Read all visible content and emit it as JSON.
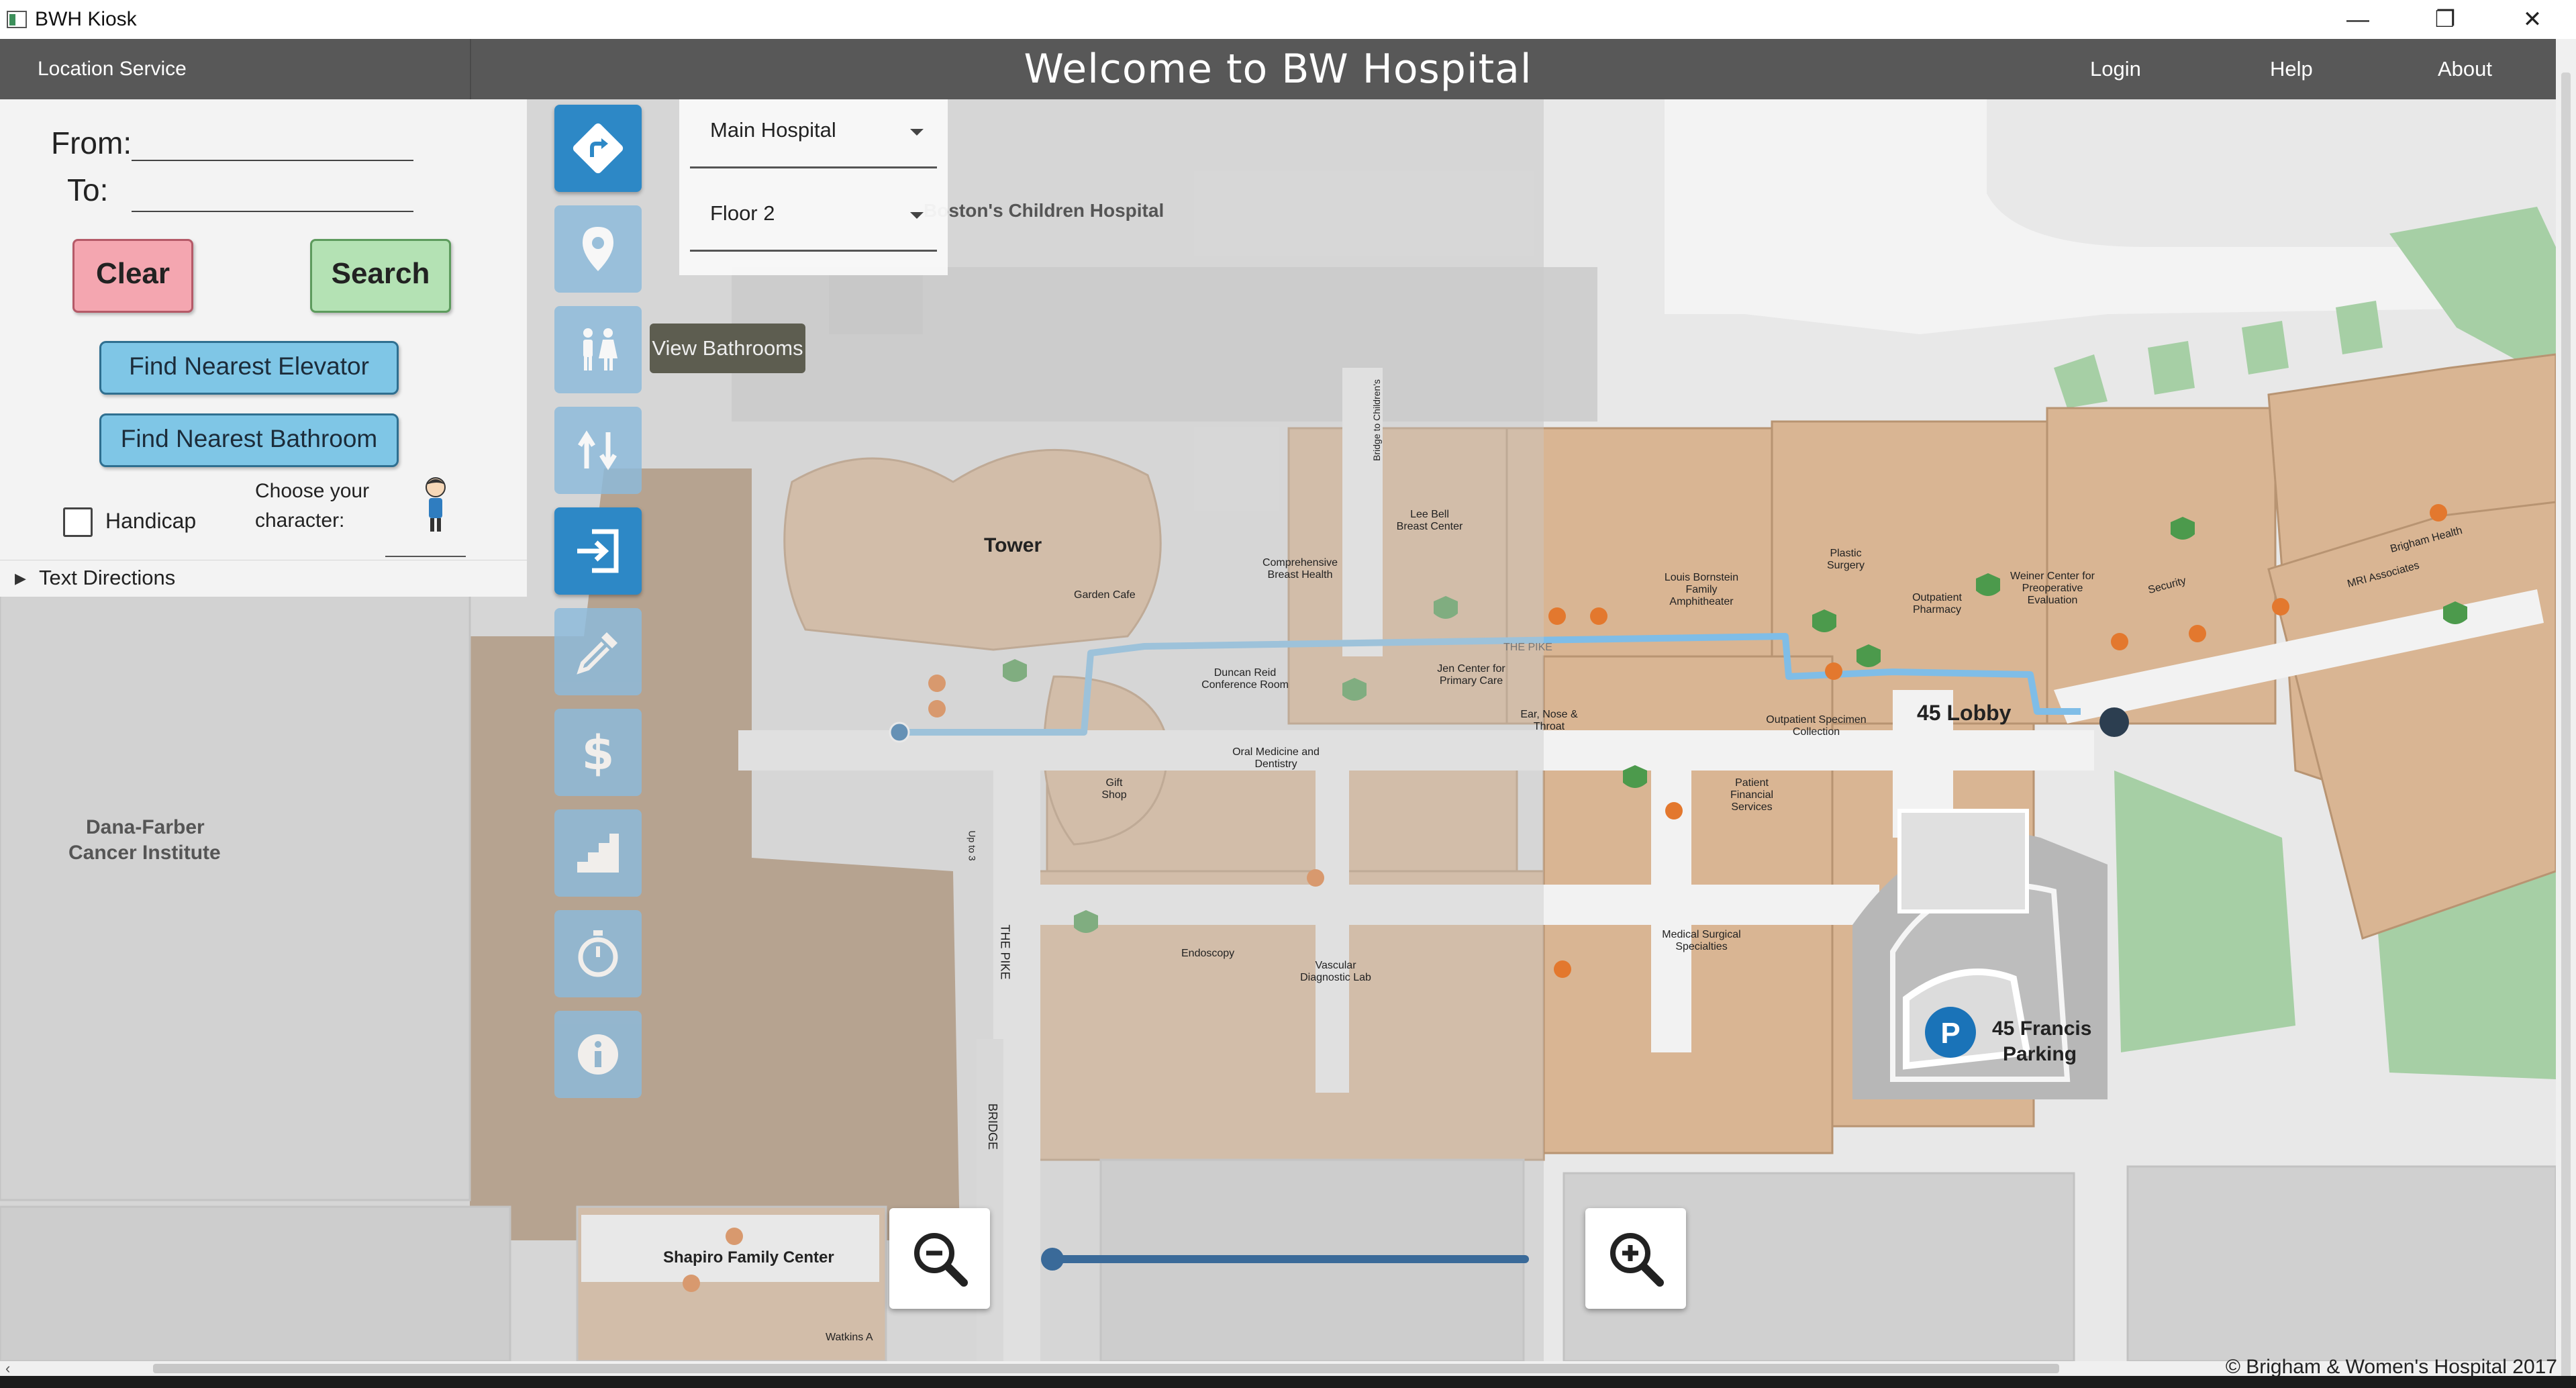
{
  "window": {
    "title": "BWH Kiosk",
    "minimize": "—",
    "restore": "❐",
    "close": "✕"
  },
  "header": {
    "service_label": "Location Service",
    "welcome": "Welcome to BW Hospital",
    "nav": [
      {
        "label": "Login"
      },
      {
        "label": "Help"
      },
      {
        "label": "About"
      }
    ]
  },
  "panel": {
    "from_label": "From:",
    "to_label": "To:",
    "from_value": "",
    "to_value": "",
    "clear_label": "Clear",
    "search_label": "Search",
    "nearest_elevator_label": "Find Nearest Elevator",
    "nearest_bathroom_label": "Find Nearest Bathroom",
    "handicap_label": "Handicap",
    "handicap_checked": false,
    "choose_character_label_1": "Choose your",
    "choose_character_label_2": "character:",
    "text_directions_label": "Text Directions"
  },
  "tools": [
    {
      "name": "directions-icon",
      "state": "active"
    },
    {
      "name": "location-pin-icon",
      "state": "dim"
    },
    {
      "name": "bathroom-icon",
      "state": "dim"
    },
    {
      "name": "elevator-icon",
      "state": "dim"
    },
    {
      "name": "enter-icon",
      "state": "active"
    },
    {
      "name": "eyedropper-icon",
      "state": "dim"
    },
    {
      "name": "dollar-icon",
      "state": "dim"
    },
    {
      "name": "stairs-icon",
      "state": "dim"
    },
    {
      "name": "stopwatch-icon",
      "state": "dim"
    },
    {
      "name": "info-icon",
      "state": "dim"
    }
  ],
  "tooltip": "View Bathrooms",
  "dropdowns": {
    "building": "Main Hospital",
    "floor": "Floor 2"
  },
  "zoom": {
    "level": 0.0,
    "zoom_out": "zoom-out-icon",
    "zoom_in": "zoom-in-icon"
  },
  "map_labels": {
    "boston_childrens": "Boston's Children Hospital",
    "tower": "Tower",
    "garden_cafe": "Garden Cafe",
    "comprehensive_breast": "Comprehensive Breast Health",
    "lee_bell": "Lee Bell Breast Center",
    "louis_bornstein": "Louis Bornstein Family Amphitheater",
    "plastic_surgery": "Plastic Surgery",
    "outpatient_pharmacy": "Outpatient Pharmacy",
    "weiner_center": "Weiner Center for Preoperative Evaluation",
    "brigham_health": "Brigham Health",
    "mri_associates": "MRI Associates",
    "security": "Security",
    "duncan_reid": "Duncan Reid Conference Room",
    "jen_center": "Jen Center for Primary Care",
    "ear_nose": "Ear, Nose & Throat",
    "outpatient_specimen": "Outpatient Specimen Collection",
    "lobby_45": "45 Lobby",
    "gift_shop": "Gift Shop",
    "oral_medicine": "Oral Medicine and Dentistry",
    "patient_financial": "Patient Financial Services",
    "medical_surgical": "Medical Surgical Specialties",
    "endoscopy": "Endoscopy",
    "vascular": "Vascular Diagnostic Lab",
    "the_pike": "THE PIKE",
    "the_pike_2": "THE PIKE",
    "bridge": "BRIDGE",
    "bridge_to_childrens": "Bridge to Children's",
    "up_to_3": "Up to 3",
    "dana_farber_1": "Dana-Farber",
    "dana_farber_2": "Cancer Institute",
    "francis_1": "45 Francis",
    "francis_2": "Parking",
    "shapiro": "Shapiro Family Center",
    "watkins": "Watkins A"
  },
  "copyright": "© Brigham & Women's Hospital 2017",
  "colors": {
    "header_bg": "#585858",
    "building": "#d9b593",
    "building_dark": "#a98868",
    "path": "#7fbde7",
    "clear_btn": "#f4a6b0",
    "search_btn": "#b4e2b4",
    "blue_btn": "#7fc6e6",
    "tool_active": "#2d88c6",
    "green_patch": "#a6cfa5"
  }
}
